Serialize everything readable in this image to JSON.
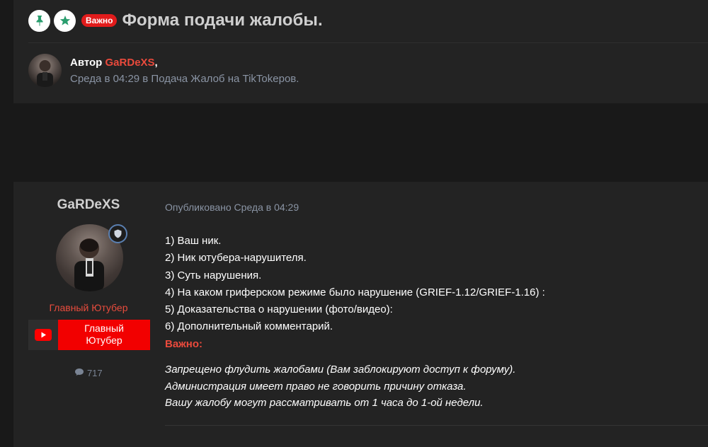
{
  "topic": {
    "pin_icon": "pin-icon",
    "featured_icon": "star-icon",
    "badge": "Важно",
    "title": "Форма подачи жалобы."
  },
  "author_block": {
    "prefix": "Автор",
    "name": "GaRDeXS",
    "suffix": ",",
    "meta": "Среда в 04:29 в Подача Жалоб на TikTokеров."
  },
  "post": {
    "username": "GaRDeXS",
    "user_title": "Главный Ютубер",
    "rank_icon": "shield-icon",
    "badge_icon": "youtube-icon",
    "badge_line1": "Главный",
    "badge_line2": "Ютубер",
    "post_count": "717",
    "published": "Опубликовано Среда в 04:29",
    "lines": [
      "1) Ваш ник.",
      "2) Ник ютубера-нарушителя.",
      "3) Суть нарушения.",
      "4) На каком гриферском режиме было нарушение (GRIEF-1.12/GRIEF-1.16) :",
      "5) Доказательства о нарушении (фото/видео):",
      "6) Дополнительный комментарий."
    ],
    "important_label": "Важно:",
    "notes": [
      "Запрещено флудить жалобами (Вам заблокируют доступ к форуму).",
      "Администрация имеет право не говорить причину отказа.",
      "Вашу жалобу могут рассматривать от 1 часа до 1-ой недели."
    ]
  },
  "colors": {
    "accent_red": "#ea4a3c",
    "badge_red": "#e11b1b",
    "youtube_red": "#f20000",
    "icon_green": "#2a9d6e",
    "rank_blue": "#5a7fb0"
  }
}
